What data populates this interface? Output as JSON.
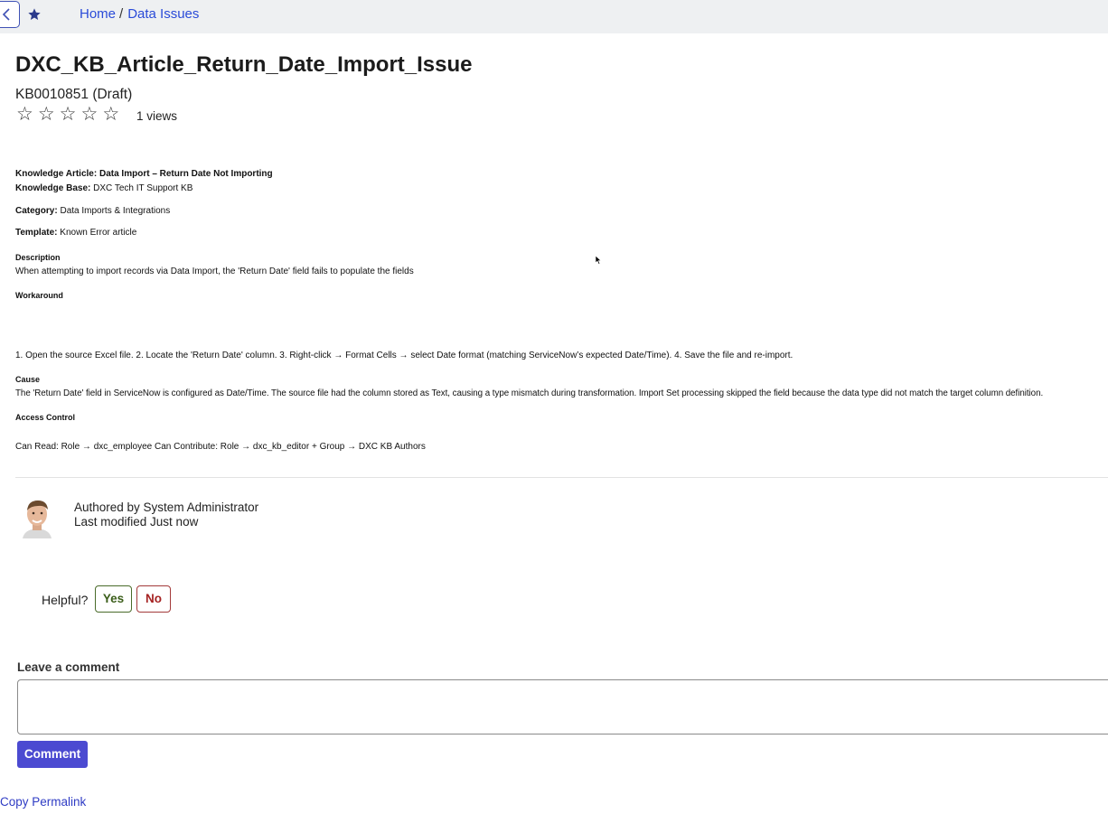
{
  "breadcrumb": {
    "home": "Home",
    "separator": "/",
    "current": "Data Issues"
  },
  "icons": {
    "back": "chevron-left-icon",
    "favorite": "star-icon"
  },
  "article": {
    "title": "DXC_KB_Article_Return_Date_Import_Issue",
    "number": "KB0010851 (Draft)",
    "rating_stars": 0,
    "rating_max": 5,
    "views": "1 views"
  },
  "content": {
    "heading": "Knowledge Article: Data Import – Return Date Not Importing",
    "kb_label": "Knowledge Base:",
    "kb_value": "DXC Tech IT Support KB",
    "category_label": "Category:",
    "category_value": "Data Imports & Integrations",
    "template_label": "Template:",
    "template_value": "Known Error article",
    "description_label": "Description",
    "description_value": "When attempting to import records via Data Import, the 'Return Date' field fails to populate the fields",
    "workaround_label": "Workaround",
    "workaround_value": "1. Open the source Excel file. 2. Locate the 'Return Date' column. 3. Right-click → Format Cells → select Date format (matching ServiceNow’s expected Date/Time). 4. Save the file and re-import.",
    "cause_label": "Cause",
    "cause_value": "The 'Return Date' field in ServiceNow is configured as Date/Time. The source file had the column stored as Text, causing a type mismatch during transformation. Import Set processing skipped the field because the data type did not match the target column definition.",
    "access_label": "Access Control",
    "access_value": "Can Read: Role → dxc_employee Can Contribute: Role → dxc_kb_editor + Group → DXC KB Authors"
  },
  "author": {
    "authored_by": "Authored by System Administrator",
    "last_modified": "Last modified Just now"
  },
  "feedback": {
    "question": "Helpful?",
    "yes": "Yes",
    "no": "No"
  },
  "comment": {
    "label": "Leave a comment",
    "value": "",
    "button": "Comment"
  },
  "permalink": "Copy Permalink",
  "colors": {
    "accent": "#4b4ad1",
    "link": "#2a4bd8",
    "yes": "#3b5e1a",
    "no": "#a52222"
  }
}
